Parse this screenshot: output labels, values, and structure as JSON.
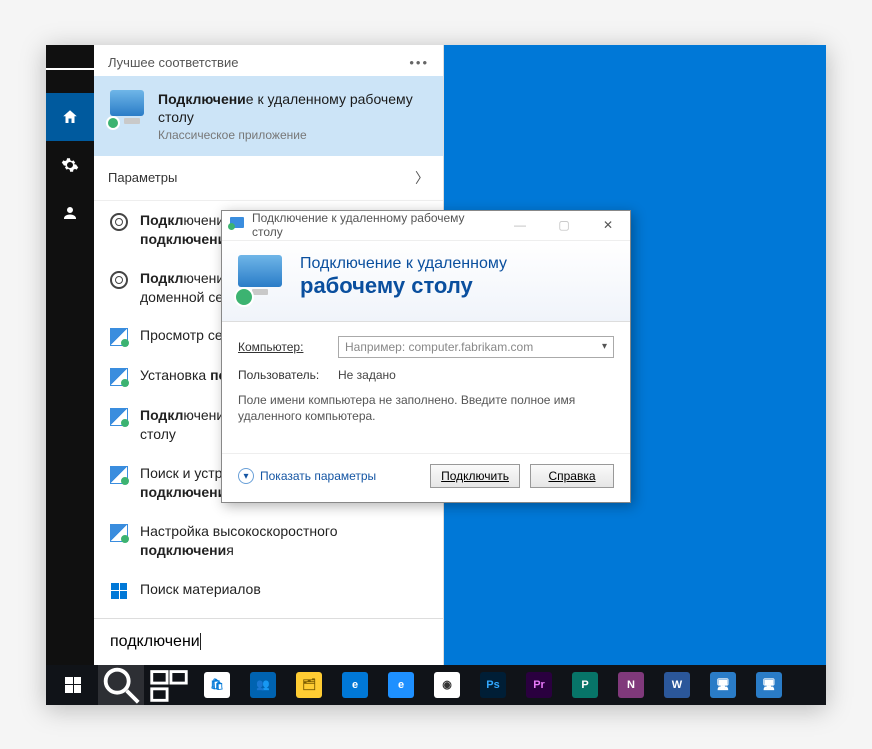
{
  "panel": {
    "header_label": "Лучшее соответствие",
    "best_match": {
      "title_prefix_bold": "Подключени",
      "title_rest": "е к удаленному рабочему столу",
      "subtitle": "Классическое приложение"
    },
    "section_settings": "Параметры",
    "results": [
      {
        "kind": "gear",
        "html": "<b>Подкл</b>ючение через лимитные <b>подключения</b> к компьютеру"
      },
      {
        "kind": "gear",
        "html": "<b>Подкл</b>ючение к рабочей или учебной доменной сети"
      },
      {
        "kind": "mixed",
        "html": "Просмотр сетевых <b>подключени</b>й"
      },
      {
        "kind": "mixed",
        "html": "Установка <b>подключени</b>я к сети"
      },
      {
        "kind": "mixed",
        "html": "<b>Подкл</b>ючение к удаленному рабочему столу"
      },
      {
        "kind": "mixed",
        "html": "Поиск и устранение проблем с сетью и <b>подключени</b>ем"
      },
      {
        "kind": "mixed",
        "html": "Настройка высокоскоростного <b>подключени</b>я"
      },
      {
        "kind": "win",
        "html": "Поиск материалов"
      }
    ],
    "search_value": "подключени"
  },
  "dialog": {
    "titlebar": "Подключение к удаленному рабочему столу",
    "banner_line1": "Подключение к удаленному",
    "banner_line2": "рабочему столу",
    "label_computer": "Компьютер:",
    "computer_placeholder": "Например: computer.fabrikam.com",
    "label_user": "Пользователь:",
    "user_value": "Не задано",
    "hint": "Поле имени компьютера не заполнено. Введите полное имя удаленного компьютера.",
    "show_options": "Показать параметры",
    "btn_connect": "Подключить",
    "btn_help": "Справка"
  },
  "taskbar": {
    "apps": [
      {
        "name": "store",
        "bg": "#ffffff",
        "fg": "#0078D7",
        "glyph": "🛍"
      },
      {
        "name": "people",
        "bg": "#0063B1",
        "fg": "#fff",
        "glyph": "👥"
      },
      {
        "name": "explorer",
        "bg": "#FFCC33",
        "fg": "#7a5b00",
        "glyph": "🗂"
      },
      {
        "name": "edge",
        "bg": "#0078D7",
        "fg": "#fff",
        "glyph": "e"
      },
      {
        "name": "ie",
        "bg": "#1E90FF",
        "fg": "#fff",
        "glyph": "e"
      },
      {
        "name": "chrome",
        "bg": "#fff",
        "fg": "#333",
        "glyph": "◉"
      },
      {
        "name": "photoshop",
        "bg": "#001E36",
        "fg": "#31A8FF",
        "glyph": "Ps"
      },
      {
        "name": "premiere",
        "bg": "#2A003F",
        "fg": "#E879F9",
        "glyph": "Pr"
      },
      {
        "name": "publisher",
        "bg": "#077568",
        "fg": "#fff",
        "glyph": "P"
      },
      {
        "name": "onenote",
        "bg": "#80397B",
        "fg": "#fff",
        "glyph": "N"
      },
      {
        "name": "word",
        "bg": "#2B579A",
        "fg": "#fff",
        "glyph": "W"
      },
      {
        "name": "mstsc",
        "bg": "#2a7cc7",
        "fg": "#fff",
        "glyph": "🖥"
      },
      {
        "name": "mstsc2",
        "bg": "#2a7cc7",
        "fg": "#fff",
        "glyph": "🖥"
      }
    ]
  }
}
